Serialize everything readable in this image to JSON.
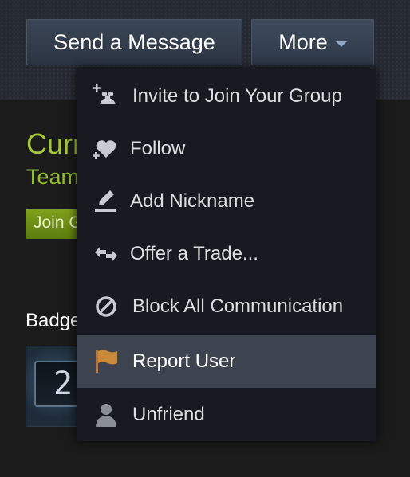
{
  "header": {
    "send_message_label": "Send a Message",
    "more_label": "More"
  },
  "background": {
    "profile_title_partial": "Curr",
    "profile_subtitle_partial": "Team",
    "join_button_partial": "Join G",
    "badges_label_partial": "Badge",
    "badge_number_partial": "2"
  },
  "dropdown": {
    "items": [
      {
        "label": "Invite to Join Your Group",
        "icon": "invite-group-icon"
      },
      {
        "label": "Follow",
        "icon": "follow-heart-icon"
      },
      {
        "label": "Add Nickname",
        "icon": "pencil-icon"
      },
      {
        "label": "Offer a Trade...",
        "icon": "trade-arrows-icon"
      },
      {
        "label": "Block All Communication",
        "icon": "block-icon"
      },
      {
        "label": "Report User",
        "icon": "flag-icon",
        "highlighted": true
      },
      {
        "label": "Unfriend",
        "icon": "person-icon"
      }
    ]
  },
  "colors": {
    "menu_bg": "#171a21",
    "menu_highlight": "#3d4450",
    "accent_green": "#a4c639",
    "flag_orange": "#c98a3c"
  }
}
